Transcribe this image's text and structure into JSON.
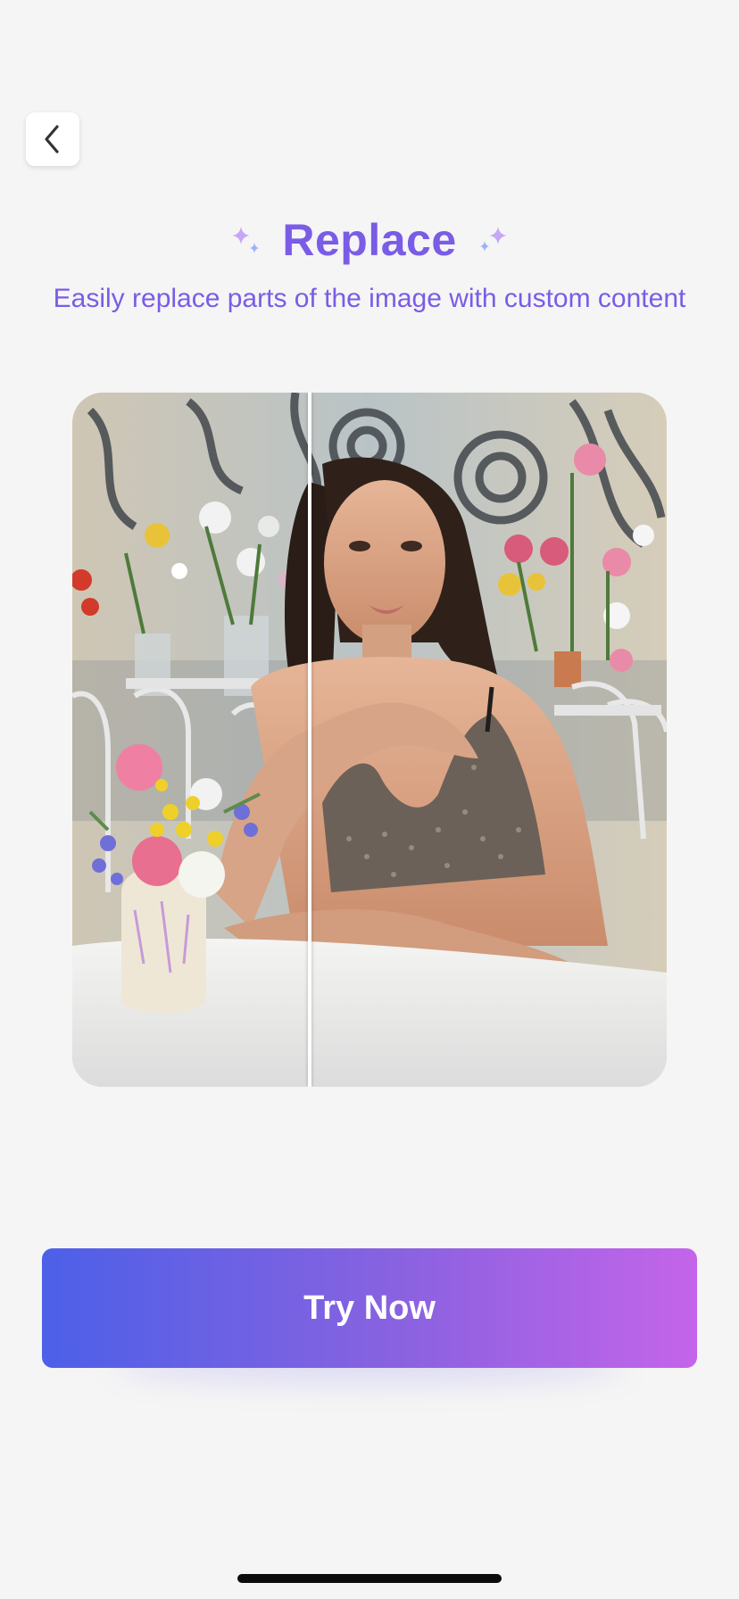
{
  "nav": {
    "back_icon": "chevron-left-icon"
  },
  "header": {
    "title": "Replace",
    "subtitle": "Easily replace parts of the image with custom content",
    "sparkle_icon": "sparkle-icon"
  },
  "preview": {
    "compare_position": 0.4
  },
  "cta": {
    "label": "Try Now"
  },
  "colors": {
    "accent": "#7a5ce6",
    "background": "#f5f5f5",
    "gradient_start": "#4c60e8",
    "gradient_end": "#c464ea"
  }
}
